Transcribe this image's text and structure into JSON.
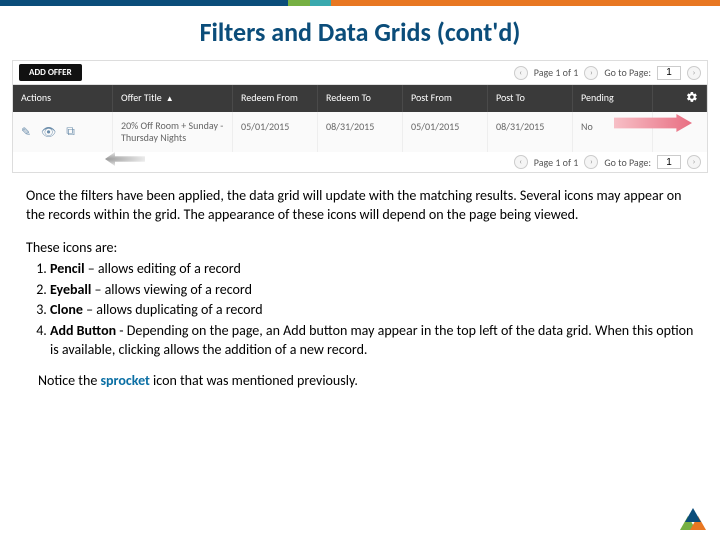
{
  "title": "Filters and Data Grids (cont'd)",
  "toolbar": {
    "add_offer": "ADD OFFER"
  },
  "pager": {
    "page_text": "Page 1 of 1",
    "goto_label": "Go to Page:",
    "page_value": "1"
  },
  "columns": {
    "actions": "Actions",
    "offer_title": "Offer Title",
    "redeem_from": "Redeem From",
    "redeem_to": "Redeem To",
    "post_from": "Post From",
    "post_to": "Post To",
    "pending": "Pending"
  },
  "row": {
    "title": "20% Off Room + Sunday - Thursday Nights",
    "redeem_from": "05/01/2015",
    "redeem_to": "08/31/2015",
    "post_from": "05/01/2015",
    "post_to": "08/31/2015",
    "pending": "No"
  },
  "body": {
    "p1": "Once the filters have been applied, the data grid will update with the matching results. Several icons may appear on the records within the grid. The appearance of these icons will depend on the page being viewed.",
    "icons_intro": "These icons are:",
    "li1_bold": "Pencil",
    "li1_rest": " – allows editing of a record",
    "li2_bold": "Eyeball",
    "li2_rest": " – allows viewing of a record",
    "li3_bold": "Clone",
    "li3_rest": " – allows duplicating of a record",
    "li4_bold": "Add Button",
    "li4_rest": " - Depending on the page, an Add button may appear in the top left of the data grid. When this option is available, clicking allows the addition of a new record.",
    "notice_a": "Notice the ",
    "notice_word": "sprocket",
    "notice_b": " icon that was mentioned previously."
  }
}
